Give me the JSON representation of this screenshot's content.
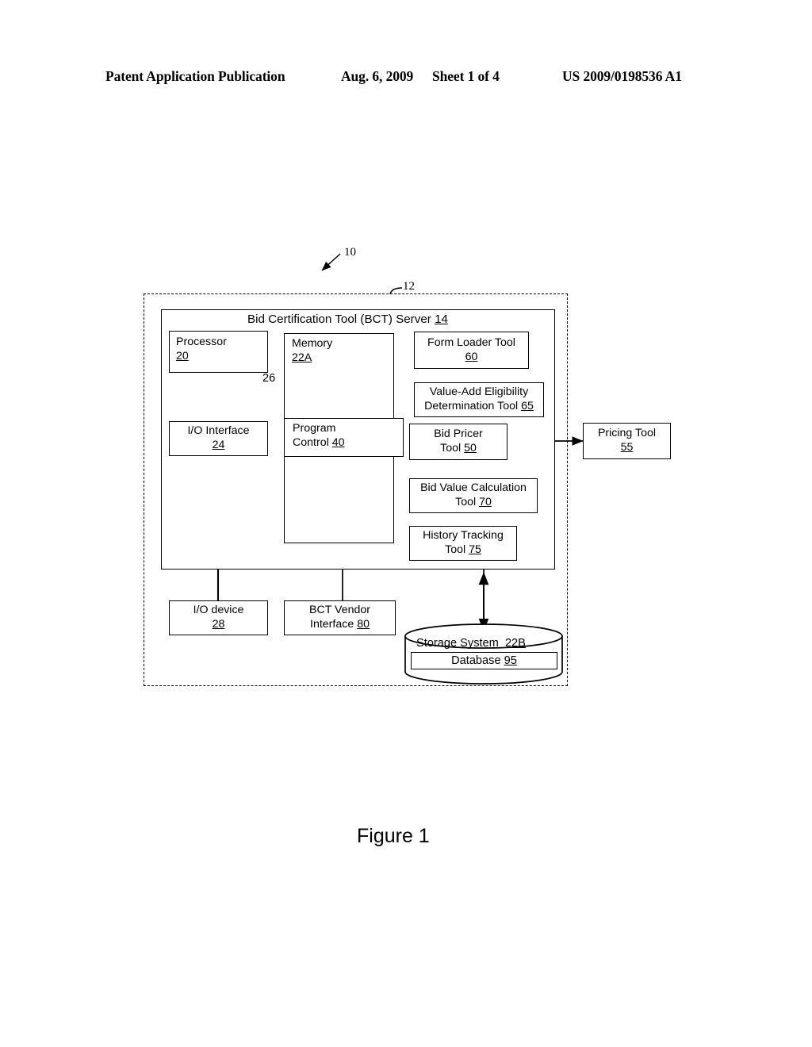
{
  "header": {
    "publication": "Patent Application Publication",
    "date": "Aug. 6, 2009",
    "sheet": "Sheet 1 of 4",
    "patent_number": "US 2009/0198536 A1"
  },
  "figure": {
    "caption": "Figure 1",
    "system_numeral": "10",
    "environment_numeral": "12",
    "bus_numeral": "26",
    "server_title_text": "Bid Certification Tool (BCT) Server",
    "server_title_numeral": "14",
    "boxes": {
      "processor": {
        "label": "Processor",
        "numeral": "20"
      },
      "memory": {
        "label": "Memory",
        "numeral": "22A"
      },
      "io_interface": {
        "label": "I/O Interface",
        "numeral": "24"
      },
      "program_control": {
        "label_line1": "Program",
        "label_line2": "Control",
        "numeral": "40"
      },
      "io_device": {
        "label": "I/O device",
        "numeral": "28"
      },
      "bct_vendor_interface": {
        "label_line1": "BCT Vendor",
        "label_line2": "Interface",
        "numeral": "80"
      },
      "form_loader_tool": {
        "label": "Form Loader Tool",
        "numeral": "60"
      },
      "value_add_tool": {
        "label_line1": "Value-Add Eligibility",
        "label_line2": "Determination Tool",
        "numeral": "65"
      },
      "bid_pricer_tool": {
        "label_line1": "Bid Pricer",
        "label_line2": "Tool",
        "numeral": "50"
      },
      "bid_value_tool": {
        "label_line1": "Bid Value Calculation",
        "label_line2": "Tool",
        "numeral": "70"
      },
      "history_tracking_tool": {
        "label_line1": "History Tracking",
        "label_line2": "Tool",
        "numeral": "75"
      },
      "pricing_tool": {
        "label": "Pricing Tool",
        "numeral": "55"
      },
      "storage_system": {
        "label": "Storage System",
        "numeral": "22B"
      },
      "database": {
        "label": "Database",
        "numeral": "95"
      }
    }
  }
}
